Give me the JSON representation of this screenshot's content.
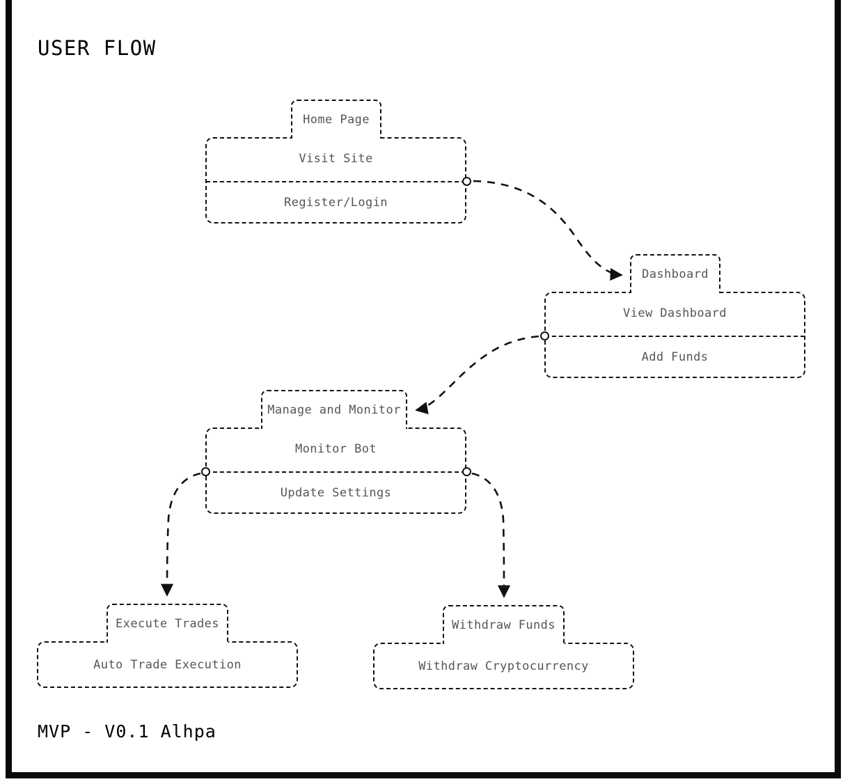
{
  "page": {
    "title": "USER FLOW",
    "footer": "MVP - V0.1 Alhpa",
    "background_color": "#ffffff",
    "border_color": "#0a0a0a",
    "stroke_color": "#111111",
    "label_color": "#555555"
  },
  "chart_data": {
    "type": "diagram",
    "title": "USER FLOW",
    "subtitle": "MVP - V0.1 Alhpa",
    "nodes": [
      {
        "id": "home",
        "tab": "Home Page",
        "rows": [
          "Visit Site",
          "Register/Login"
        ]
      },
      {
        "id": "dashboard",
        "tab": "Dashboard",
        "rows": [
          "View Dashboard",
          "Add Funds"
        ]
      },
      {
        "id": "manage",
        "tab": "Manage and Monitor",
        "rows": [
          "Monitor Bot",
          "Update Settings"
        ]
      },
      {
        "id": "execute",
        "tab": "Execute Trades",
        "rows": [
          "Auto Trade Execution"
        ]
      },
      {
        "id": "withdraw",
        "tab": "Withdraw Funds",
        "rows": [
          "Withdraw Cryptocurrency"
        ]
      }
    ],
    "edges": [
      {
        "from": "home",
        "to": "dashboard",
        "style": "dashed",
        "arrow": "right"
      },
      {
        "from": "dashboard",
        "to": "manage",
        "style": "dashed",
        "arrow": "left"
      },
      {
        "from": "manage",
        "to": "execute",
        "style": "dashed",
        "arrow": "down"
      },
      {
        "from": "manage",
        "to": "withdraw",
        "style": "dashed",
        "arrow": "down"
      }
    ]
  },
  "groups": {
    "home": {
      "tab": "Home Page",
      "row1": "Visit Site",
      "row2": "Register/Login"
    },
    "dashboard": {
      "tab": "Dashboard",
      "row1": "View Dashboard",
      "row2": "Add Funds"
    },
    "manage": {
      "tab": "Manage and Monitor",
      "row1": "Monitor Bot",
      "row2": "Update Settings"
    },
    "execute": {
      "tab": "Execute Trades",
      "row1": "Auto Trade Execution"
    },
    "withdraw": {
      "tab": "Withdraw Funds",
      "row1": "Withdraw Cryptocurrency"
    }
  }
}
